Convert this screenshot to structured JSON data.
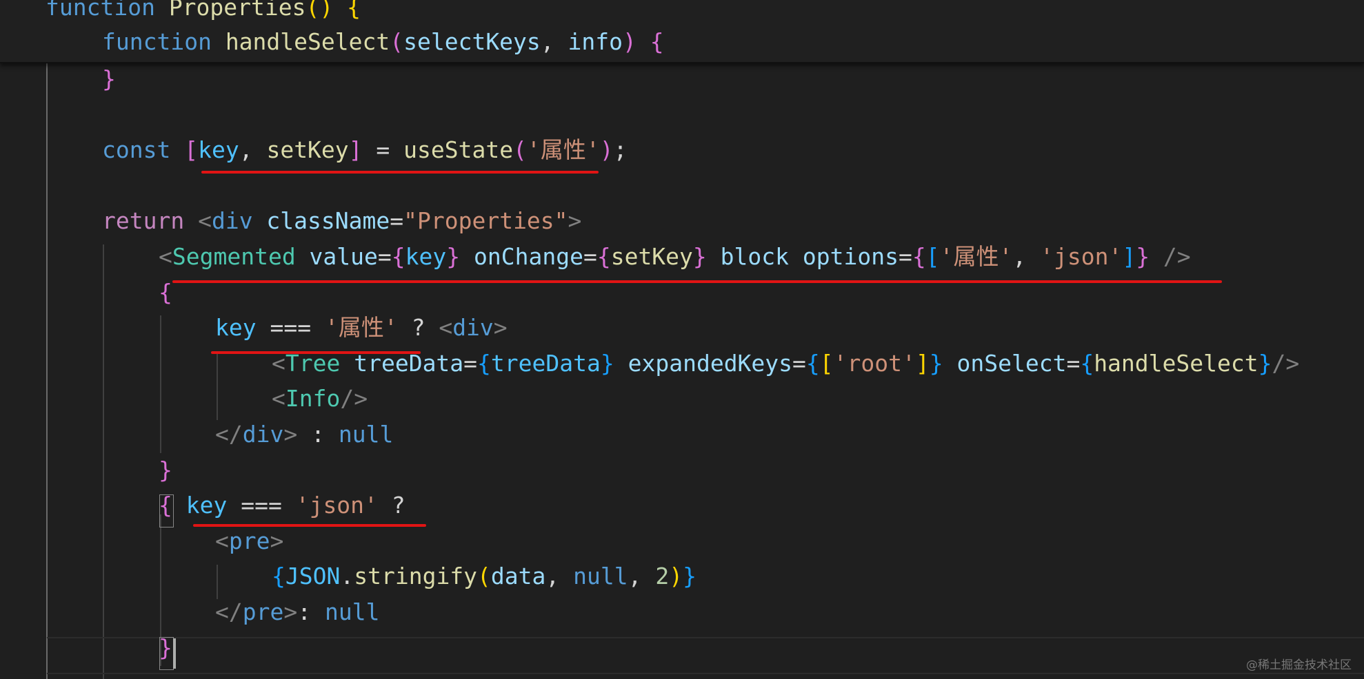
{
  "sticky_lines": [
    {
      "tokens": [
        [
          "function ",
          "t-kw"
        ],
        [
          "Properties",
          "t-fn"
        ],
        [
          "() {",
          "t-b1"
        ]
      ]
    },
    {
      "tokens": [
        [
          "function ",
          "t-kw"
        ],
        [
          "handleSelect",
          "t-fn"
        ],
        [
          "(",
          "t-b2"
        ],
        [
          "selectKeys",
          "t-prop"
        ],
        [
          ", ",
          "t-plain"
        ],
        [
          "info",
          "t-prop"
        ],
        [
          ") {",
          "t-b2"
        ]
      ]
    }
  ],
  "code_lines": [
    {
      "tokens": [
        [
          "}",
          "t-b2"
        ]
      ]
    },
    {
      "tokens": []
    },
    {
      "tokens": [
        [
          "const ",
          "t-kw"
        ],
        [
          "[",
          "t-b2"
        ],
        [
          "key",
          "t-var"
        ],
        [
          ", ",
          "t-plain"
        ],
        [
          "setKey",
          "t-fn"
        ],
        [
          "]",
          "t-b2"
        ],
        [
          " = ",
          "t-plain"
        ],
        [
          "useState",
          "t-fn"
        ],
        [
          "(",
          "t-b2"
        ],
        [
          "'属性'",
          "t-str"
        ],
        [
          ")",
          "t-b2"
        ],
        [
          ";",
          "t-plain"
        ]
      ]
    },
    {
      "tokens": []
    },
    {
      "tokens": [
        [
          "return ",
          "t-kw2"
        ],
        [
          "<",
          "t-punc"
        ],
        [
          "div",
          "t-html"
        ],
        [
          " className",
          "t-prop"
        ],
        [
          "=",
          "t-plain"
        ],
        [
          "\"Properties\"",
          "t-str"
        ],
        [
          ">",
          "t-punc"
        ]
      ]
    },
    {
      "tokens": [
        [
          "<",
          "t-punc"
        ],
        [
          "Segmented",
          "t-tag"
        ],
        [
          " value",
          "t-prop"
        ],
        [
          "=",
          "t-plain"
        ],
        [
          "{",
          "t-b2"
        ],
        [
          "key",
          "t-var"
        ],
        [
          "}",
          "t-b2"
        ],
        [
          " onChange",
          "t-prop"
        ],
        [
          "=",
          "t-plain"
        ],
        [
          "{",
          "t-b2"
        ],
        [
          "setKey",
          "t-fn"
        ],
        [
          "}",
          "t-b2"
        ],
        [
          " block",
          "t-prop"
        ],
        [
          " options",
          "t-prop"
        ],
        [
          "=",
          "t-plain"
        ],
        [
          "{",
          "t-b2"
        ],
        [
          "[",
          "t-b3"
        ],
        [
          "'属性'",
          "t-str"
        ],
        [
          ", ",
          "t-plain"
        ],
        [
          "'json'",
          "t-str"
        ],
        [
          "]",
          "t-b3"
        ],
        [
          "}",
          "t-b2"
        ],
        [
          " />",
          "t-punc"
        ]
      ]
    },
    {
      "tokens": [
        [
          "{",
          "t-b2"
        ]
      ]
    },
    {
      "tokens": [
        [
          "key",
          "t-var"
        ],
        [
          " === ",
          "t-plain"
        ],
        [
          "'属性'",
          "t-str"
        ],
        [
          " ? ",
          "t-plain"
        ],
        [
          "<",
          "t-punc"
        ],
        [
          "div",
          "t-html"
        ],
        [
          ">",
          "t-punc"
        ]
      ]
    },
    {
      "tokens": [
        [
          "<",
          "t-punc"
        ],
        [
          "Tree",
          "t-tag"
        ],
        [
          " treeData",
          "t-prop"
        ],
        [
          "=",
          "t-plain"
        ],
        [
          "{",
          "t-b3"
        ],
        [
          "treeData",
          "t-var"
        ],
        [
          "}",
          "t-b3"
        ],
        [
          " expandedKeys",
          "t-prop"
        ],
        [
          "=",
          "t-plain"
        ],
        [
          "{",
          "t-b3"
        ],
        [
          "[",
          "t-b1"
        ],
        [
          "'root'",
          "t-str"
        ],
        [
          "]",
          "t-b1"
        ],
        [
          "}",
          "t-b3"
        ],
        [
          " onSelect",
          "t-prop"
        ],
        [
          "=",
          "t-plain"
        ],
        [
          "{",
          "t-b3"
        ],
        [
          "handleSelect",
          "t-fn"
        ],
        [
          "}",
          "t-b3"
        ],
        [
          "/>",
          "t-punc"
        ]
      ]
    },
    {
      "tokens": [
        [
          "<",
          "t-punc"
        ],
        [
          "Info",
          "t-tag"
        ],
        [
          "/>",
          "t-punc"
        ]
      ]
    },
    {
      "tokens": [
        [
          "</",
          "t-punc"
        ],
        [
          "div",
          "t-html"
        ],
        [
          ">",
          "t-punc"
        ],
        [
          " : ",
          "t-plain"
        ],
        [
          "null",
          "t-kw"
        ]
      ]
    },
    {
      "tokens": [
        [
          "}",
          "t-b2"
        ]
      ]
    },
    {
      "tokens": [
        [
          "{",
          "t-b2"
        ],
        [
          " key",
          "t-var"
        ],
        [
          " === ",
          "t-plain"
        ],
        [
          "'json'",
          "t-str"
        ],
        [
          " ?",
          "t-plain"
        ]
      ]
    },
    {
      "tokens": [
        [
          "<",
          "t-punc"
        ],
        [
          "pre",
          "t-html"
        ],
        [
          ">",
          "t-punc"
        ]
      ]
    },
    {
      "tokens": [
        [
          "{",
          "t-b3"
        ],
        [
          "JSON",
          "t-var"
        ],
        [
          ".",
          "t-plain"
        ],
        [
          "stringify",
          "t-fn"
        ],
        [
          "(",
          "t-b1"
        ],
        [
          "data",
          "t-prop"
        ],
        [
          ", ",
          "t-plain"
        ],
        [
          "null",
          "t-kw"
        ],
        [
          ", ",
          "t-plain"
        ],
        [
          "2",
          "t-num"
        ],
        [
          ")",
          "t-b1"
        ],
        [
          "}",
          "t-b3"
        ]
      ]
    },
    {
      "tokens": [
        [
          "</",
          "t-punc"
        ],
        [
          "pre",
          "t-html"
        ],
        [
          ">",
          "t-punc"
        ],
        [
          ": ",
          "t-plain"
        ],
        [
          "null",
          "t-kw"
        ]
      ]
    },
    {
      "tokens": [
        [
          "}",
          "t-b2"
        ]
      ]
    }
  ],
  "watermark": "@稀土掘金技术社区",
  "colors": {
    "background": "#1f1f1f",
    "underline": "#e01414",
    "keyword": "#569cd6",
    "control_keyword": "#c586c0",
    "function": "#dcdcaa",
    "variable": "#4fc1ff",
    "property": "#9cdcfe",
    "string": "#ce9178",
    "component": "#4ec9b0"
  }
}
